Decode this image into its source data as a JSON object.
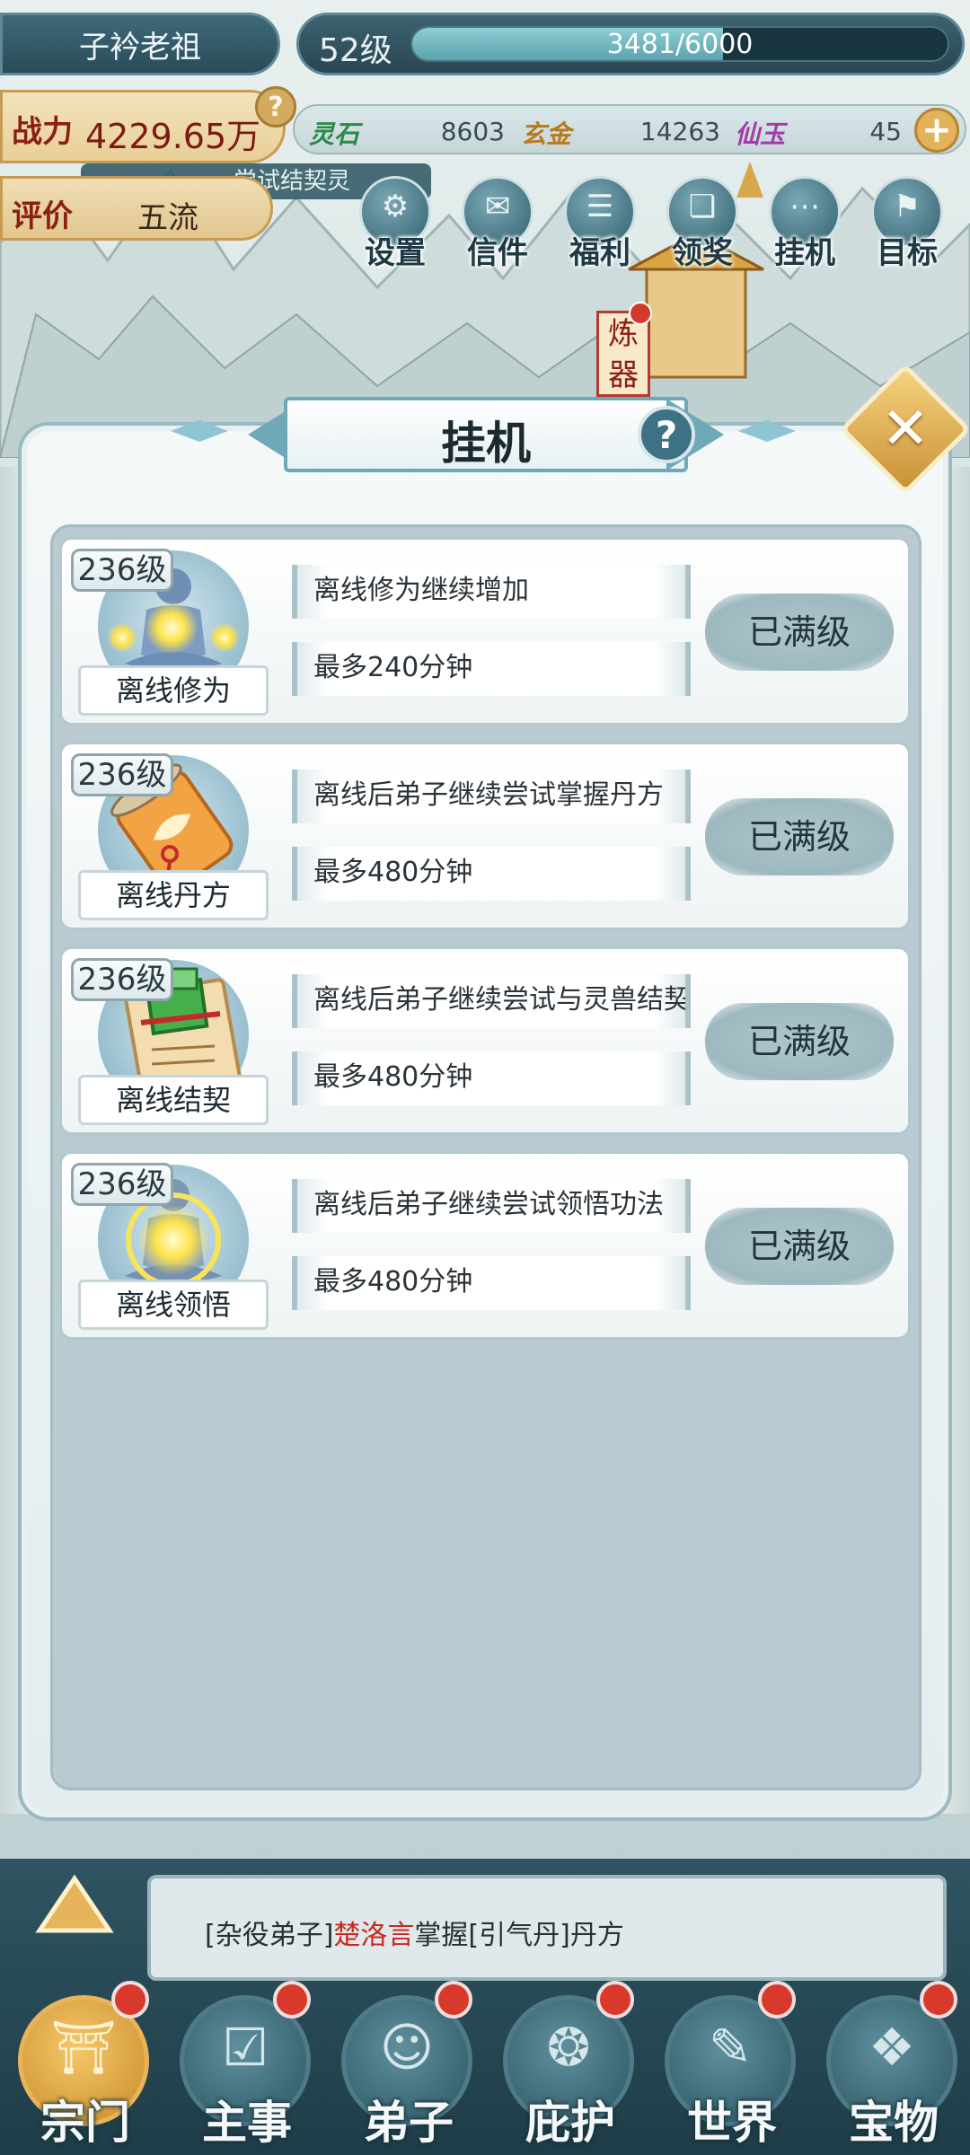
{
  "header": {
    "player_name": "子衿老祖",
    "level_label": "52级",
    "exp_text": "3481/6000",
    "exp_fraction": 0.58,
    "power_label": "战力",
    "power_value": "4229.65万",
    "help_glyph": "?",
    "rating_label": "评价",
    "rating_value": "五流",
    "task_hint": "尝试结契灵",
    "resources": [
      {
        "label": "灵石",
        "value": "8603",
        "color": "#2b8a4a"
      },
      {
        "label": "玄金",
        "value": "14263",
        "color": "#b8791a"
      },
      {
        "label": "仙玉",
        "value": "45",
        "color": "#a23ca8"
      }
    ],
    "plus_glyph": "+"
  },
  "top_icons": [
    {
      "label": "设置",
      "icon": "gear-icon",
      "glyph": "⚙"
    },
    {
      "label": "信件",
      "icon": "mail-icon",
      "glyph": "✉"
    },
    {
      "label": "福利",
      "icon": "gift-list-icon",
      "glyph": "☰"
    },
    {
      "label": "领奖",
      "icon": "scroll-icon",
      "glyph": "❏"
    },
    {
      "label": "挂机",
      "icon": "idle-icon",
      "glyph": "⋯"
    },
    {
      "label": "目标",
      "icon": "target-icon",
      "glyph": "⚑"
    }
  ],
  "map": {
    "forge_label": "炼器"
  },
  "panel": {
    "title": "挂机",
    "help_glyph": "?",
    "close_glyph": "✕",
    "rows": [
      {
        "level": "236级",
        "name": "离线修为",
        "desc": "离线修为继续增加",
        "cap": "最多240分钟",
        "button": "已满级",
        "art": "meditation-figure-icon"
      },
      {
        "level": "236级",
        "name": "离线丹方",
        "desc": "离线后弟子继续尝试掌握丹方",
        "cap": "最多480分钟",
        "button": "已满级",
        "art": "recipe-scroll-icon"
      },
      {
        "level": "236级",
        "name": "离线结契",
        "desc": "离线后弟子继续尝试与灵兽结契",
        "cap": "最多480分钟",
        "button": "已满级",
        "art": "contract-scroll-icon"
      },
      {
        "level": "236级",
        "name": "离线领悟",
        "desc": "离线后弟子继续尝试领悟功法",
        "cap": "最多480分钟",
        "button": "已满级",
        "art": "enlightenment-orb-icon"
      }
    ]
  },
  "message": {
    "prefix": "[杂役弟子]",
    "name": "楚洛言",
    "mid": "掌握",
    "item": "[引气丹]",
    "suffix": "丹方"
  },
  "nav": [
    {
      "label": "宗门",
      "icon": "sect-icon",
      "glyph": "⛩",
      "active": true
    },
    {
      "label": "主事",
      "icon": "checklist-icon",
      "glyph": "☑",
      "active": false
    },
    {
      "label": "弟子",
      "icon": "disciple-icon",
      "glyph": "☺",
      "active": false
    },
    {
      "label": "庇护",
      "icon": "beast-icon",
      "glyph": "❂",
      "active": false
    },
    {
      "label": "世界",
      "icon": "world-scroll-icon",
      "glyph": "✎",
      "active": false
    },
    {
      "label": "宝物",
      "icon": "treasure-bag-icon",
      "glyph": "❖",
      "active": false
    }
  ]
}
